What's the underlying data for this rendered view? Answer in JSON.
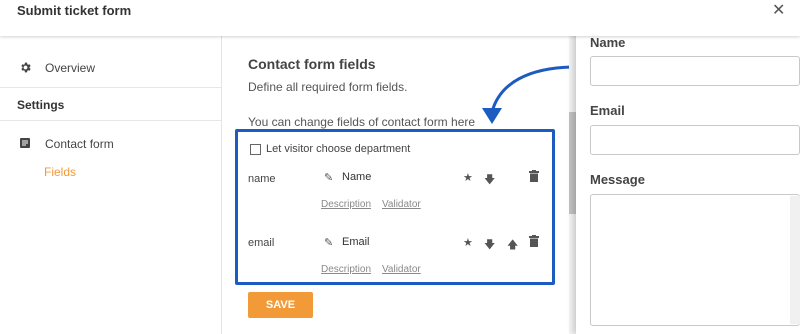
{
  "window": {
    "title": "Submit ticket form",
    "close_symbol": "✕"
  },
  "sidebar": {
    "overview_label": "Overview",
    "section_title": "Settings",
    "contact_form_label": "Contact form",
    "fields_label": "Fields"
  },
  "main": {
    "title": "Contact form fields",
    "subtitle": "Define all required form fields.",
    "hint": "You can change fields of contact form here",
    "department_checkbox_label": "Let visitor choose department",
    "fields": [
      {
        "key": "name",
        "label": "Name",
        "description_link": "Description",
        "validator_link": "Validator"
      },
      {
        "key": "email",
        "label": "Email",
        "description_link": "Description",
        "validator_link": "Validator"
      }
    ],
    "save_label": "SAVE"
  },
  "preview": {
    "name_label": "Name",
    "email_label": "Email",
    "message_label": "Message"
  },
  "colors": {
    "accent": "#f29a38",
    "highlight": "#1c5bc1"
  },
  "icons": [
    "gear-icon",
    "form-icon",
    "pencil-icon",
    "star-icon",
    "arrow-down-icon",
    "arrow-up-icon",
    "trash-icon",
    "close-icon",
    "curved-arrow-icon"
  ]
}
